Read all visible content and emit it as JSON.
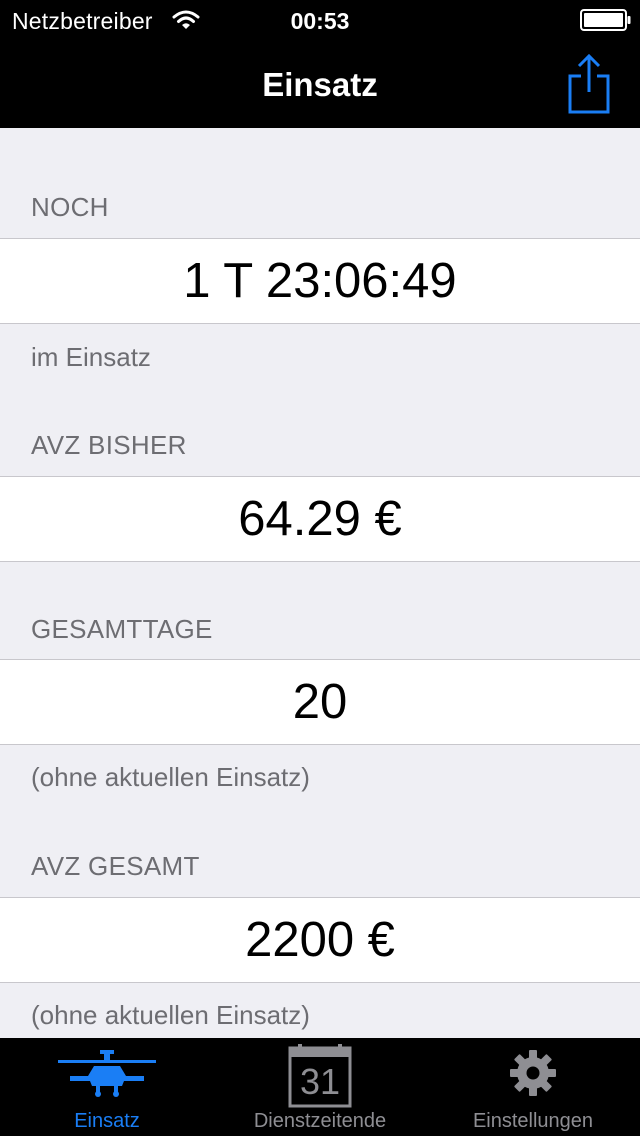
{
  "status_bar": {
    "carrier": "Netzbetreiber",
    "time": "00:53",
    "wifi_icon": "wifi-icon",
    "battery_icon": "battery-icon"
  },
  "nav_bar": {
    "title": "Einsatz",
    "share_icon": "share-icon"
  },
  "sections": [
    {
      "header": "NOCH",
      "value": "1 T 23:06:49",
      "footer": "im Einsatz"
    },
    {
      "header": "AVZ BISHER",
      "value": "64.29 €",
      "footer": ""
    },
    {
      "header": "GESAMTTAGE",
      "value": "20",
      "footer": "(ohne aktuellen Einsatz)"
    },
    {
      "header": "AVZ GESAMT",
      "value": "2200 €",
      "footer": "(ohne aktuellen Einsatz)"
    }
  ],
  "tab_bar": {
    "tabs": [
      {
        "label": "Einsatz",
        "icon": "helicopter-icon",
        "selected": true
      },
      {
        "label": "Dienstzeitende",
        "icon": "calendar-icon",
        "calendar_day": "31",
        "selected": false
      },
      {
        "label": "Einstellungen",
        "icon": "gear-icon",
        "selected": false
      }
    ]
  },
  "colors": {
    "accent": "#1a7ef5",
    "bar_background": "#000000",
    "group_background": "#efeff4",
    "section_text": "#6d6d72",
    "inactive_tab": "#8e8e93"
  }
}
